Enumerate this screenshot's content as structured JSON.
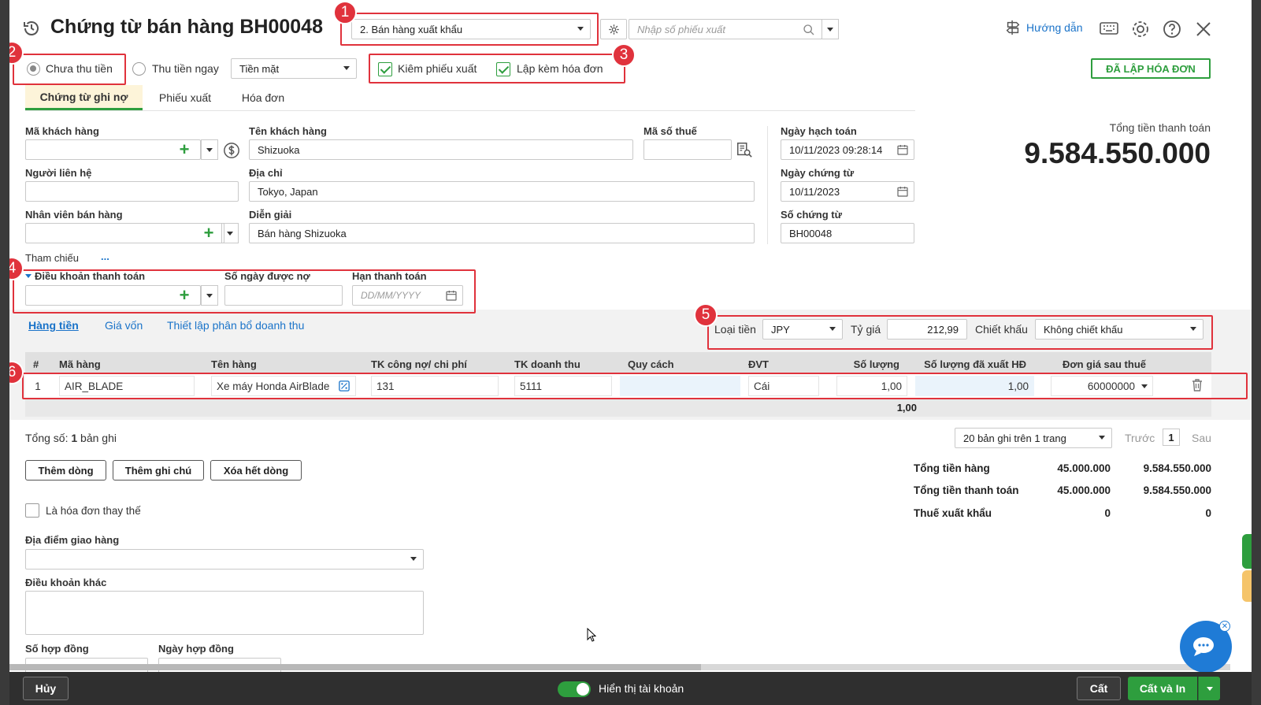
{
  "header": {
    "title": "Chứng từ bán hàng BH00048",
    "voucher_type": "2. Bán hàng xuất khẩu",
    "search_placeholder": "Nhập số phiếu xuất",
    "help_label": "Hướng dẫn",
    "invoice_status": "ĐÃ LẬP HÓA ĐƠN"
  },
  "payment": {
    "unpaid_label": "Chưa thu tiền",
    "paid_now_label": "Thu tiền ngay",
    "method": "Tiền mặt",
    "unpaid_selected": true
  },
  "options": {
    "kiem_phieu_xuat": "Kiêm phiếu xuất",
    "lap_kem_hoa_don": "Lập kèm hóa đơn"
  },
  "tabs": [
    {
      "label": "Chứng từ ghi nợ"
    },
    {
      "label": "Phiếu xuất"
    },
    {
      "label": "Hóa đơn"
    }
  ],
  "form": {
    "ma_khach_hang_label": "Mã khách hàng",
    "ma_khach_hang_value": "",
    "ten_khach_hang_label": "Tên khách hàng",
    "ten_khach_hang_value": "Shizuoka",
    "ma_so_thue_label": "Mã số thuế",
    "ma_so_thue_value": "",
    "nguoi_lien_he_label": "Người liên hệ",
    "nguoi_lien_he_value": "",
    "dia_chi_label": "Địa chỉ",
    "dia_chi_value": "Tokyo, Japan",
    "nhan_vien_label": "Nhân viên bán hàng",
    "nhan_vien_value": "",
    "dien_giai_label": "Diễn giải",
    "dien_giai_value": "Bán hàng Shizuoka",
    "tham_chieu_label": "Tham chiếu",
    "tham_chieu_more": "...",
    "ngay_hach_toan_label": "Ngày hạch toán",
    "ngay_hach_toan_value": "10/11/2023 09:28:14",
    "ngay_chung_tu_label": "Ngày chứng từ",
    "ngay_chung_tu_value": "10/11/2023",
    "so_chung_tu_label": "Số chứng từ",
    "so_chung_tu_value": "BH00048"
  },
  "total": {
    "label": "Tổng tiền thanh toán",
    "value": "9.584.550.000"
  },
  "terms": {
    "dieu_khoan_label": "Điều khoản thanh toán",
    "so_ngay_label": "Số ngày được nợ",
    "han_thanh_toan_label": "Hạn thanh toán",
    "han_thanh_toan_placeholder": "DD/MM/YYYY"
  },
  "subtabs": [
    {
      "label": "Hàng tiền"
    },
    {
      "label": "Giá vốn"
    },
    {
      "label": "Thiết lập phân bổ doanh thu"
    }
  ],
  "currency": {
    "loai_tien_label": "Loại tiền",
    "loai_tien_value": "JPY",
    "ty_gia_label": "Tỷ giá",
    "ty_gia_value": "212,99",
    "chiet_khau_label": "Chiết khấu",
    "chiet_khau_value": "Không chiết khấu"
  },
  "table": {
    "headers": [
      "#",
      "Mã hàng",
      "Tên hàng",
      "TK công nợ/ chi phí",
      "TK doanh thu",
      "Quy cách",
      "ĐVT",
      "Số lượng",
      "Số lượng đã xuất HĐ",
      "Đơn giá sau thuế"
    ],
    "rows": [
      {
        "no": "1",
        "ma_hang": "AIR_BLADE",
        "ten_hang": "Xe máy Honda AirBlade",
        "tk_cong_no": "131",
        "tk_doanh_thu": "5111",
        "quy_cach": "",
        "dvt": "Cái",
        "so_luong": "1,00",
        "so_luong_da_xuat": "1,00",
        "don_gia": "60000000"
      }
    ],
    "total_qty": "1,00",
    "record_count_prefix": "Tổng số: ",
    "record_count": "1",
    "record_count_suffix": " bản ghi",
    "paging_select": "20 bản ghi trên 1 trang",
    "prev_label": "Trước",
    "page": "1",
    "next_label": "Sau"
  },
  "actions": {
    "add_row": "Thêm dòng",
    "add_note": "Thêm ghi chú",
    "clear_rows": "Xóa hết dòng"
  },
  "summary": [
    {
      "label": "Tổng tiền hàng",
      "value1": "45.000.000",
      "value2": "9.584.550.000"
    },
    {
      "label": "Tổng tiền thanh toán",
      "value1": "45.000.000",
      "value2": "9.584.550.000"
    },
    {
      "label": "Thuế xuất khẩu",
      "value1": "0",
      "value2": "0"
    }
  ],
  "extra": {
    "replacement_invoice_label": "Là hóa đơn thay thế",
    "dia_diem_label": "Địa điểm giao hàng",
    "dieu_khoan_khac_label": "Điều khoản khác",
    "so_hop_dong_label": "Số hợp đồng",
    "ngay_hop_dong_label": "Ngày hợp đồng"
  },
  "footer": {
    "cancel_label": "Hủy",
    "show_account_label": "Hiển thị tài khoản",
    "save_label": "Cất",
    "save_print_label": "Cất và In"
  },
  "annotations": [
    "1",
    "2",
    "3",
    "4",
    "5",
    "6"
  ],
  "colors": {
    "accent_green": "#2e9e3e",
    "annotation_red": "#e0323c",
    "link_blue": "#1a73c9"
  }
}
